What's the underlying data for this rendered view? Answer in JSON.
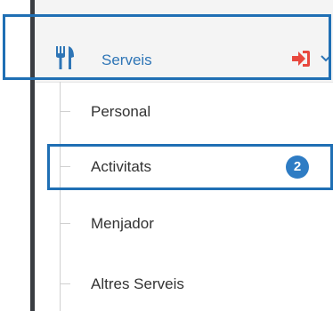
{
  "menu": {
    "title": "Serveis",
    "icons": {
      "menu_icon": "cutlery-icon",
      "action_icon": "sign-in-icon",
      "expand_icon": "chevron-down-icon"
    },
    "colors": {
      "accent": "#2e75b6",
      "action": "#e8483e",
      "badge": "#2e7cc4",
      "highlight_outline": "#1f6fb4"
    }
  },
  "submenu": {
    "items": [
      {
        "label": "Personal"
      },
      {
        "label": "Activitats",
        "badge": "2"
      },
      {
        "label": "Menjador"
      },
      {
        "label": "Altres Serveis"
      }
    ]
  }
}
